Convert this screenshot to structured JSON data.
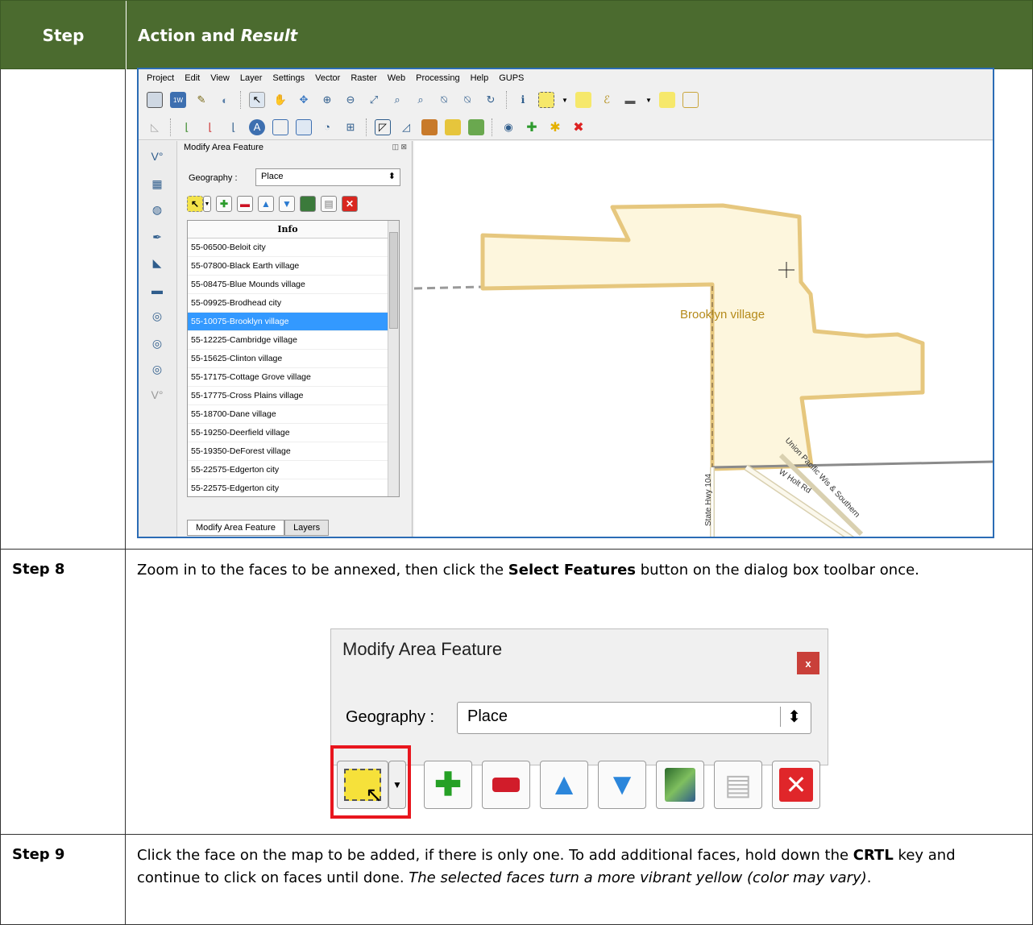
{
  "header": {
    "step": "Step",
    "action": "Action and ",
    "result": "Result"
  },
  "qgis": {
    "menu": [
      "Project",
      "Edit",
      "View",
      "Layer",
      "Settings",
      "Vector",
      "Raster",
      "Web",
      "Processing",
      "Help",
      "GUPS"
    ],
    "panel_title": "Modify Area Feature",
    "geography_label": "Geography :",
    "geography_value": "Place",
    "list_header": "Info",
    "list_items": [
      "55-06500-Beloit city",
      "55-07800-Black Earth village",
      "55-08475-Blue Mounds village",
      "55-09925-Brodhead city",
      "55-10075-Brooklyn village",
      "55-12225-Cambridge village",
      "55-15625-Clinton village",
      "55-17175-Cottage Grove village",
      "55-17775-Cross Plains village",
      "55-18700-Dane village",
      "55-19250-Deerfield village",
      "55-19350-DeForest village",
      "55-22575-Edgerton city",
      "55-22575-Edgerton city"
    ],
    "selected_item": "55-10075-Brooklyn village",
    "tabs": [
      "Modify Area Feature",
      "Layers"
    ],
    "map_labels": {
      "place": "Brooklyn village",
      "road1": "State Hwy 104",
      "road2": "W Holt Rd",
      "rail": "Union Pacific Wis & Southern"
    },
    "colors": {
      "polygon_fill": "#fdf6dd",
      "polygon_stroke": "#e6c77e",
      "place_label": "#b58a1a",
      "selection": "#3399ff"
    }
  },
  "step8": {
    "label": "Step 8",
    "text_1": "Zoom in to the faces to be annexed, then click the ",
    "bold_1": "Select Features",
    "text_2": " button on the dialog box toolbar once.",
    "dialog": {
      "title": "Modify Area Feature",
      "close": "x",
      "geography_label": "Geography :",
      "geography_value": "Place"
    }
  },
  "step9": {
    "label": "Step 9",
    "text_1": "Click the face on the map to be added, if there is only one. To add additional faces, hold down the ",
    "bold_1": "CRTL",
    "text_2": " key and continue to click on faces until done. ",
    "italic_1": "The selected faces turn a more vibrant yellow (color may vary)",
    "text_3": "."
  }
}
